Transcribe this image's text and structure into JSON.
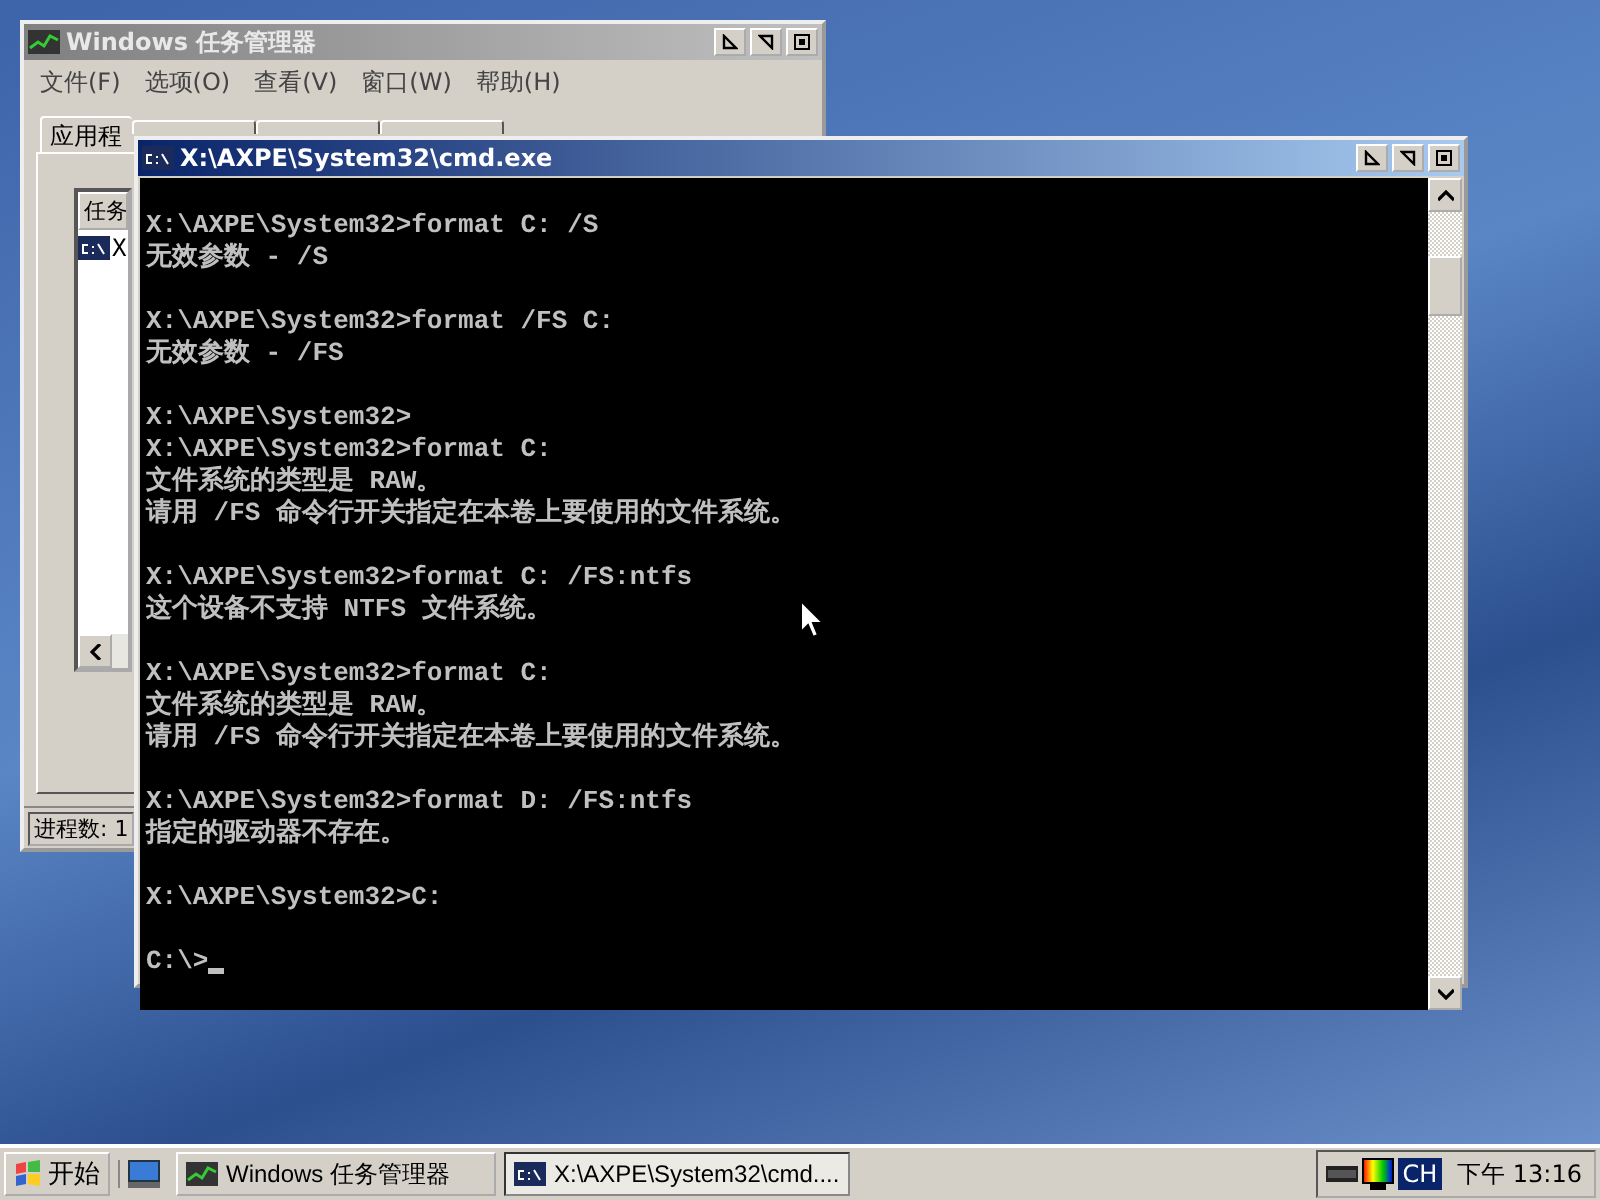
{
  "task_manager": {
    "title": "Windows 任务管理器",
    "active": false,
    "menu": [
      "文件(F)",
      "选项(O)",
      "查看(V)",
      "窗口(W)",
      "帮助(H)"
    ],
    "tabs": [
      {
        "label": "应用程",
        "selected": true
      },
      {
        "selected": false
      },
      {
        "selected": false
      },
      {
        "selected": false
      }
    ],
    "list_header": "任务",
    "list_rows": [
      {
        "text": "X",
        "selected": false
      }
    ],
    "status_bar": "进程数: 1"
  },
  "console": {
    "title": "X:\\AXPE\\System32\\cmd.exe",
    "active": true,
    "cursor_visible": true,
    "blocks": [
      [
        "X:\\AXPE\\System32>format C: /S",
        "无效参数 - /S"
      ],
      [
        "X:\\AXPE\\System32>format /FS C:",
        "无效参数 - /FS"
      ],
      [
        "X:\\AXPE\\System32>",
        "X:\\AXPE\\System32>format C:",
        "文件系统的类型是 RAW。",
        "请用 /FS 命令行开关指定在本卷上要使用的文件系统。"
      ],
      [
        "X:\\AXPE\\System32>format C: /FS:ntfs",
        "这个设备不支持 NTFS 文件系统。"
      ],
      [
        "X:\\AXPE\\System32>format C:",
        "文件系统的类型是 RAW。",
        "请用 /FS 命令行开关指定在本卷上要使用的文件系统。"
      ],
      [
        "X:\\AXPE\\System32>format D: /FS:ntfs",
        "指定的驱动器不存在。"
      ],
      [
        "X:\\AXPE\\System32>C:"
      ],
      [
        "C:\\>"
      ]
    ]
  },
  "taskbar": {
    "start": "开始",
    "tasks": [
      {
        "label": "Windows 任务管理器",
        "kind": "taskmgr",
        "selected": false
      },
      {
        "label": "X:\\AXPE\\System32\\cmd....",
        "kind": "console",
        "selected": true
      }
    ],
    "language": "CH",
    "clock": "下午 13:16"
  }
}
